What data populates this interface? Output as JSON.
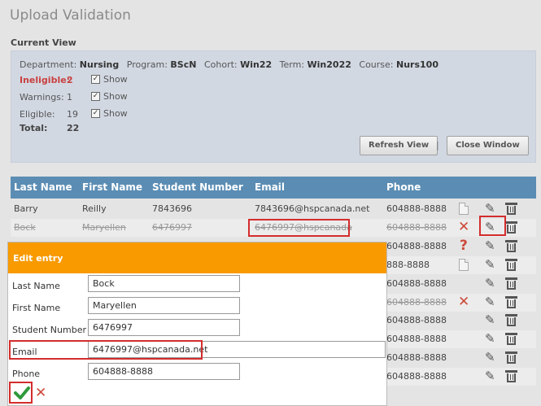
{
  "page": {
    "title": "Upload Validation",
    "section_label": "Current View"
  },
  "context": [
    {
      "label": "Department:",
      "value": "Nursing"
    },
    {
      "label": "Program:",
      "value": "BScN"
    },
    {
      "label": "Cohort:",
      "value": "Win22"
    },
    {
      "label": "Term:",
      "value": "Win2022"
    },
    {
      "label": "Course:",
      "value": "Nurs100"
    }
  ],
  "stats": {
    "ineligible": {
      "label": "Ineligible:",
      "value": "2",
      "show": "Show"
    },
    "warnings": {
      "label": "Warnings:",
      "value": "1",
      "show": "Show"
    },
    "eligible": {
      "label": "Eligible:",
      "value": "19",
      "show": "Show"
    },
    "total": {
      "label": "Total:",
      "value": "22"
    }
  },
  "buttons": {
    "refresh": "Refresh View",
    "close": "Close Window",
    "sep": "|"
  },
  "table": {
    "headers": [
      "Last Name",
      "First Name",
      "Student Number",
      "Email",
      "Phone"
    ],
    "rows": [
      {
        "last": "Barry",
        "first": "Reilly",
        "num": "7843696",
        "email": "7843696@hspcanada.net",
        "phone": "604888-8888",
        "status": "doc"
      },
      {
        "last": "Bock",
        "first": "Maryellen",
        "num": "6476997",
        "email": "6476997@hspcanada",
        "phone": "604888-8888",
        "status": "x"
      },
      {
        "last": "",
        "first": "",
        "num": "",
        "email": "",
        "phone": "604888-8888",
        "status": "q"
      },
      {
        "last": "",
        "first": "",
        "num": "",
        "email": "",
        "phone": "888-8888",
        "status": "doc"
      },
      {
        "last": "",
        "first": "",
        "num": "",
        "email": "",
        "phone": "604888-8888",
        "status": ""
      },
      {
        "last": "",
        "first": "",
        "num": "",
        "email": "",
        "phone": "604888-8888",
        "status": "x"
      },
      {
        "last": "",
        "first": "",
        "num": "",
        "email": "",
        "phone": "604888-8888",
        "status": ""
      },
      {
        "last": "",
        "first": "",
        "num": "",
        "email": "",
        "phone": "604888-8888",
        "status": ""
      },
      {
        "last": "",
        "first": "",
        "num": "",
        "email": "",
        "phone": "604888-8888",
        "status": ""
      },
      {
        "last": "",
        "first": "",
        "num": "",
        "email": "",
        "phone": "604888-8888",
        "status": ""
      }
    ]
  },
  "modal": {
    "title": "Edit entry",
    "fields": [
      {
        "label": "Last Name",
        "value": "Bock"
      },
      {
        "label": "First Name",
        "value": "Maryellen"
      },
      {
        "label": "Student Number",
        "value": "6476997"
      },
      {
        "label": "Email",
        "value": "6476997@hspcanada.net"
      },
      {
        "label": "Phone",
        "value": "604888-8888"
      }
    ]
  },
  "colors": {
    "header": "#5b8db4",
    "modal_header": "#f89a00",
    "error": "#cc4a3a",
    "highlight": "#d42d2d",
    "confirm": "#2e9a3a"
  }
}
